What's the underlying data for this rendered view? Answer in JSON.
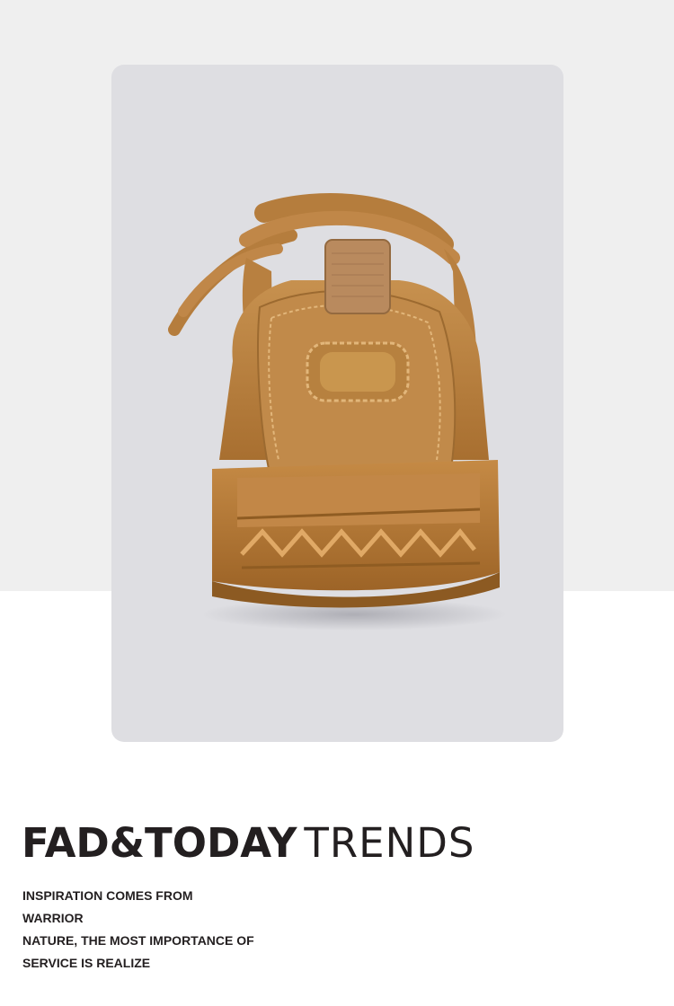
{
  "hero": {
    "image": "sneaker-rear-view",
    "colors": {
      "page_top": "#efefef",
      "card": "#dedee2",
      "shoe": "#c48a4a"
    }
  },
  "headline": {
    "bold": "FAD&TODAY",
    "light": "TRENDS"
  },
  "tagline": {
    "lines": [
      "INSPIRATION COMES FROM",
      "WARRIOR",
      "NATURE, THE MOST IMPORTANCE OF",
      "SERVICE IS REALIZE"
    ]
  }
}
